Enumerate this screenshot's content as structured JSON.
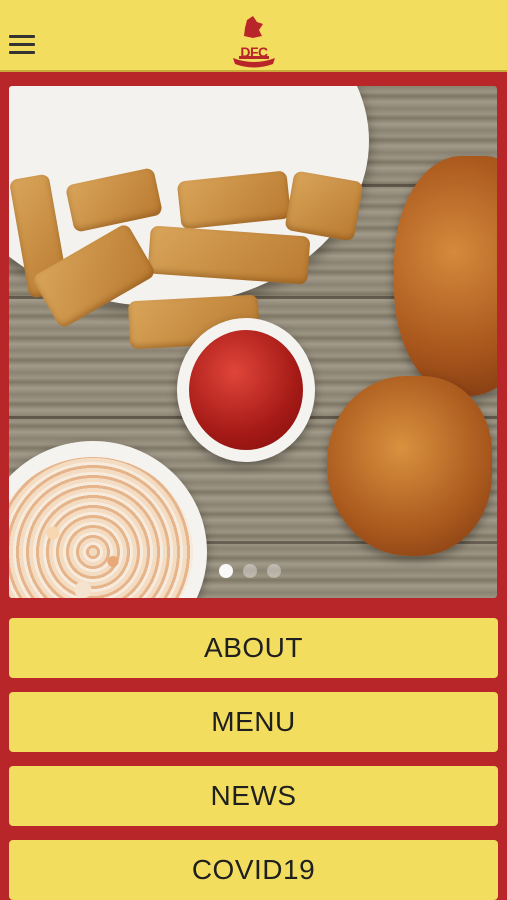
{
  "header": {
    "menu_icon": "hamburger-icon",
    "logo": {
      "text": "DFC",
      "icon": "dfc-logo-icon"
    }
  },
  "colors": {
    "header_bg": "#f2dd5e",
    "brand_red": "#b8262a",
    "button_bg": "#f2dd5e",
    "button_text": "#1f1f1f"
  },
  "carousel": {
    "slide_count": 3,
    "active_index": 0
  },
  "buttons": [
    {
      "label": "ABOUT"
    },
    {
      "label": "MENU"
    },
    {
      "label": "NEWS"
    },
    {
      "label": "COVID19"
    }
  ]
}
